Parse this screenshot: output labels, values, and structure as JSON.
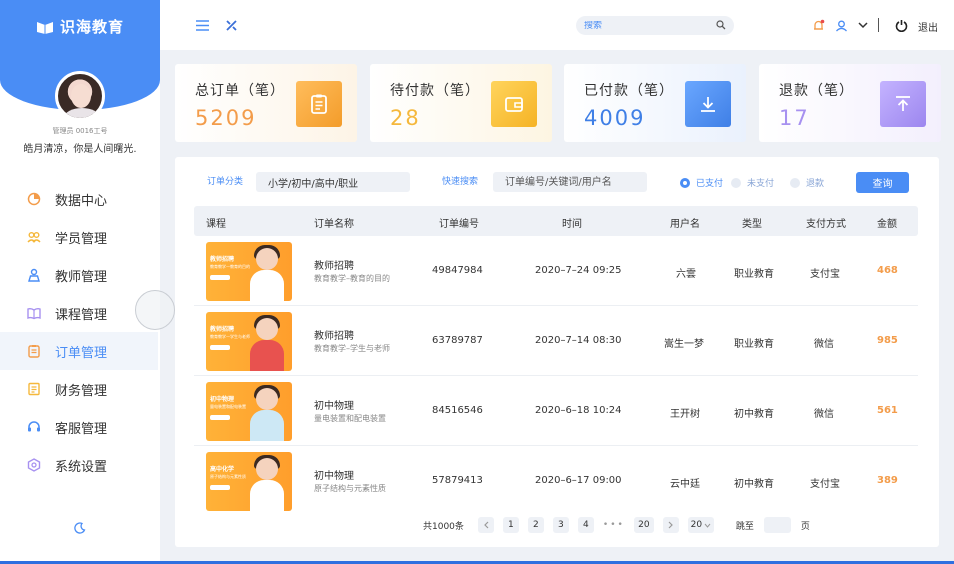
{
  "app": {
    "name": "识海教育"
  },
  "user": {
    "admin_id": "管理员 0016工号",
    "motto": "皓月清凉，你是人间曙光."
  },
  "sidebar": {
    "items": [
      {
        "label": "数据中心",
        "icon": "chart-pie-icon"
      },
      {
        "label": "学员管理",
        "icon": "users-icon"
      },
      {
        "label": "教师管理",
        "icon": "teacher-icon"
      },
      {
        "label": "课程管理",
        "icon": "book-icon"
      },
      {
        "label": "订单管理",
        "icon": "clipboard-icon",
        "active": true
      },
      {
        "label": "财务管理",
        "icon": "ledger-icon"
      },
      {
        "label": "客服管理",
        "icon": "headset-icon"
      },
      {
        "label": "系统设置",
        "icon": "settings-hex-icon"
      }
    ]
  },
  "topbar": {
    "search_placeholder": "搜索",
    "logout_label": "退出"
  },
  "stats": [
    {
      "title": "总订单（笔）",
      "value": "5209",
      "color": "#f39c4a",
      "icon": "clipboard-icon"
    },
    {
      "title": "待付款（笔）",
      "value": "28",
      "color": "#f5b83c",
      "icon": "wallet-icon"
    },
    {
      "title": "已付款（笔）",
      "value": "4009",
      "color": "#3f7fe6",
      "icon": "download-icon"
    },
    {
      "title": "退款（笔）",
      "value": "17",
      "color": "#a791f0",
      "icon": "upload-icon"
    }
  ],
  "filters": {
    "category_label": "订单分类",
    "category_value": "小学/初中/高中/职业",
    "search_label": "快速搜索",
    "search_placeholder": "订单编号/关键词/用户名",
    "radios": [
      {
        "label": "已支付",
        "checked": true
      },
      {
        "label": "未支付",
        "checked": false
      },
      {
        "label": "退款",
        "checked": false
      }
    ],
    "query_button": "查询"
  },
  "table": {
    "columns": [
      "课程",
      "订单名称",
      "订单编号",
      "时间",
      "用户名",
      "类型",
      "支付方式",
      "金额"
    ],
    "rows": [
      {
        "thumb_title": "教师招聘",
        "thumb_sub": "教育教学—教育的目的",
        "name": "教师招聘",
        "sub": "教育教学–教育的目的",
        "order_no": "49847984",
        "time": "2020–7–24 09:25",
        "user": "六雲",
        "type": "职业教育",
        "pay": "支付宝",
        "amount": "468"
      },
      {
        "thumb_title": "教师招聘",
        "thumb_sub": "教育教学—学生与老师",
        "name": "教师招聘",
        "sub": "教育教学–学生与老师",
        "order_no": "63789787",
        "time": "2020–7–14 08:30",
        "user": "嵩生一梦",
        "type": "职业教育",
        "pay": "微信",
        "amount": "985"
      },
      {
        "thumb_title": "初中物理",
        "thumb_sub": "量电装置和配电装置",
        "name": "初中物理",
        "sub": "量电装置和配电装置",
        "order_no": "84516546",
        "time": "2020–6–18 10:24",
        "user": "王开树",
        "type": "初中教育",
        "pay": "微信",
        "amount": "561"
      },
      {
        "thumb_title": "高中化学",
        "thumb_sub": "原子结构与元素性质",
        "name": "初中物理",
        "sub": "原子结构与元素性质",
        "order_no": "57879413",
        "time": "2020–6–17 09:00",
        "user": "云中廷",
        "type": "初中教育",
        "pay": "支付宝",
        "amount": "389"
      }
    ]
  },
  "pagination": {
    "total": "共1000条",
    "pages": [
      "1",
      "2",
      "3",
      "4"
    ],
    "last": "20",
    "page_size": "20",
    "goto_label": "跳至",
    "page_suffix": "页"
  }
}
